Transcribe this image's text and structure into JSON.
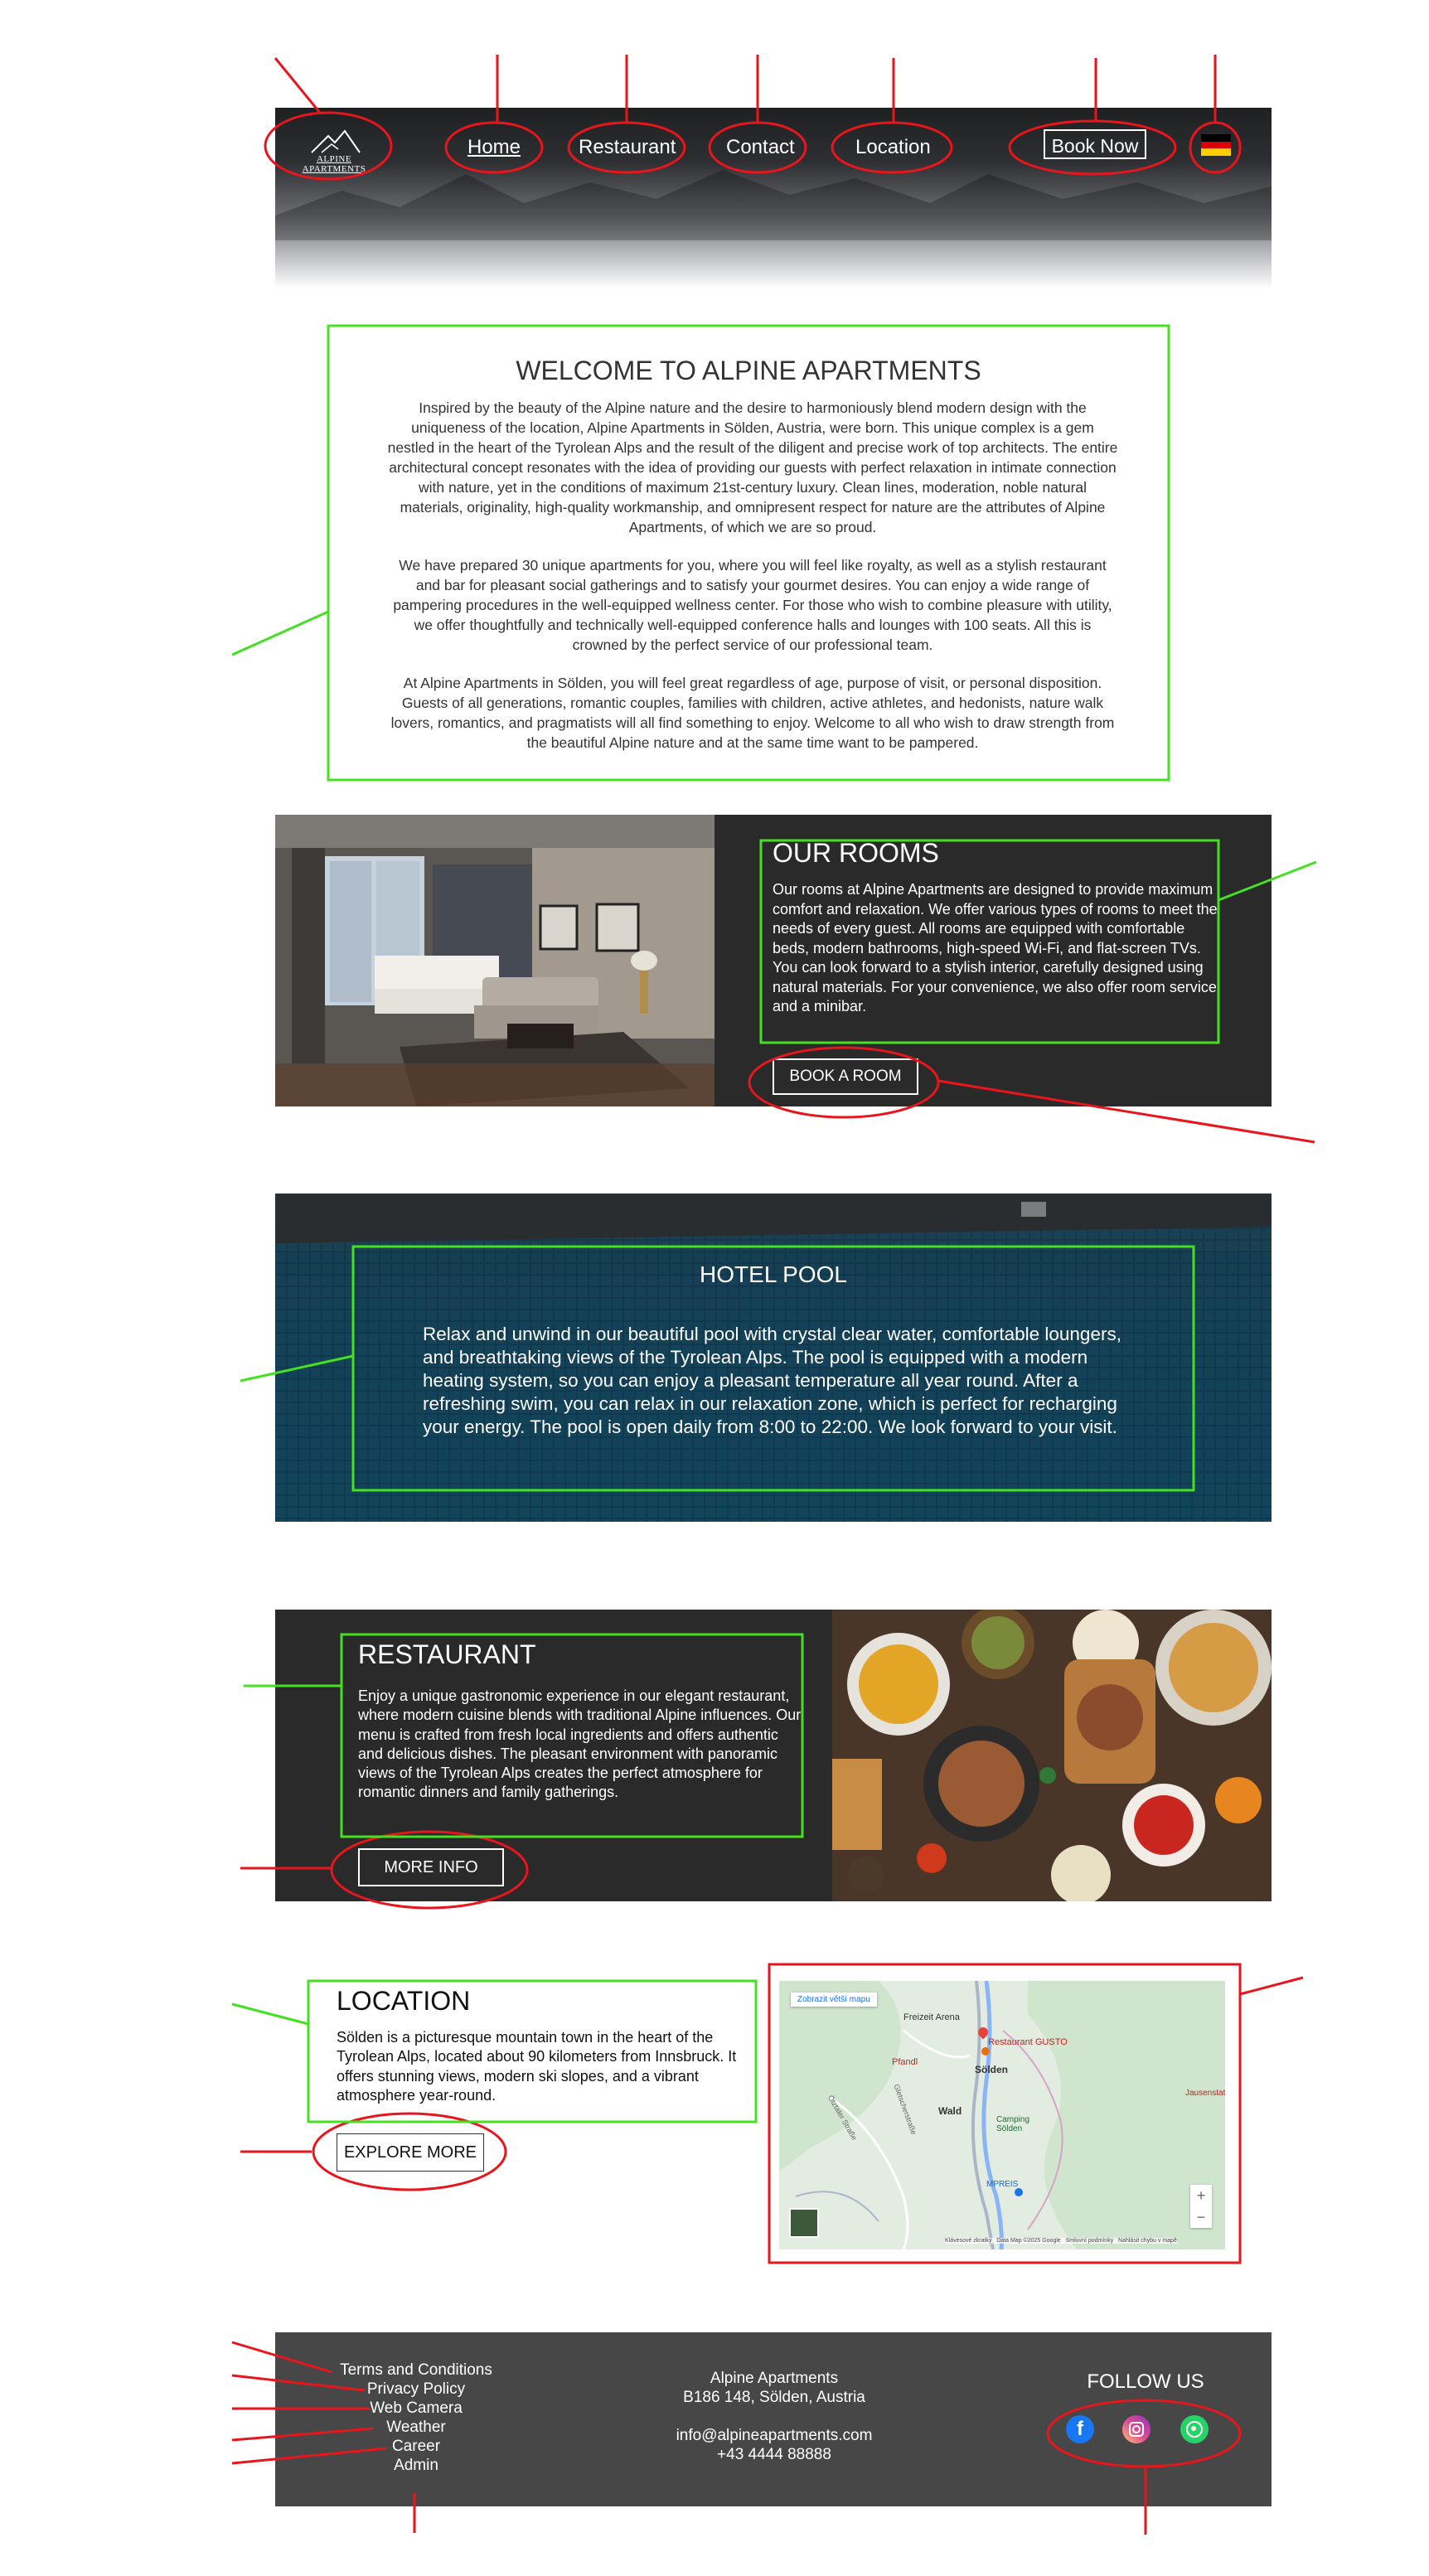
{
  "header": {
    "logo_text": "ALPINE APARTMENTS",
    "nav": [
      "Home",
      "Restaurant",
      "Contact",
      "Location"
    ],
    "book_now": "Book Now",
    "language_flag": "german-flag-icon"
  },
  "welcome": {
    "title": "WELCOME TO ALPINE APARTMENTS",
    "paragraphs": [
      "Inspired by the beauty of the Alpine nature and the desire to harmoniously blend modern design with the uniqueness of the location, Alpine Apartments in Sölden, Austria, were born. This unique complex is a gem nestled in the heart of the Tyrolean Alps and the result of the diligent and precise work of top architects. The entire architectural concept resonates with the idea of providing our guests with perfect relaxation in intimate connection with nature, yet in the conditions of maximum 21st-century luxury. Clean lines, moderation, noble natural materials, originality, high-quality workmanship, and omnipresent respect for nature are the attributes of Alpine Apartments, of which we are so proud.",
      "We have prepared 30 unique apartments for you, where you will feel like royalty, as well as a stylish restaurant and bar for pleasant social gatherings and to satisfy your gourmet desires. You can enjoy a wide range of pampering procedures in the well-equipped wellness center. For those who wish to combine pleasure with utility, we offer thoughtfully and technically well-equipped conference halls and lounges with 100 seats. All this is crowned by the perfect service of our professional team.",
      "At Alpine Apartments in Sölden, you will feel great regardless of age, purpose of visit, or personal disposition. Guests of all generations, romantic couples, families with children, active athletes, and hedonists, nature walk lovers, romantics, and pragmatists will all find something to enjoy. Welcome to all who wish to draw strength from the beautiful Alpine nature and at the same time want to be pampered."
    ]
  },
  "rooms": {
    "title": "OUR ROOMS",
    "text": "Our rooms at Alpine Apartments are designed to provide maximum comfort and relaxation. We offer various types of rooms to meet the needs of every guest. All rooms are equipped with comfortable beds, modern bathrooms, high-speed Wi-Fi, and flat-screen TVs. You can look forward to a stylish interior, carefully designed using natural materials. For your convenience, we also offer room service and a minibar.",
    "button": "BOOK A ROOM"
  },
  "pool": {
    "title": "HOTEL POOL",
    "text": "Relax and unwind in our beautiful pool with crystal clear water, comfortable loungers, and breathtaking views of the Tyrolean Alps. The pool is equipped with a modern heating system, so you can enjoy a pleasant temperature all year round. After a refreshing swim, you can relax in our relaxation zone, which is perfect for recharging your energy. The pool is open daily from 8:00 to 22:00. We look forward to your visit."
  },
  "restaurant": {
    "title": "RESTAURANT",
    "text": "Enjoy a unique gastronomic experience in our elegant restaurant, where modern cuisine blends with traditional Alpine influences. Our menu is crafted from fresh local ingredients and offers authentic and delicious dishes. The pleasant environment with panoramic views of the Tyrolean Alps creates the perfect atmosphere for romantic dinners and family gatherings.",
    "button": "MORE INFO"
  },
  "location": {
    "title": "LOCATION",
    "text": "Sölden is a picturesque mountain town in the heart of the Tyrolean Alps, located about 90 kilometers from Innsbruck. It offers stunning views, modern ski slopes, and a vibrant atmosphere year-round.",
    "button": "EXPLORE MORE",
    "map": {
      "larger_map": "Zobrazit větší mapu",
      "labels": [
        "Freizeit Arena",
        "Restaurant GUSTO",
        "Pfandl",
        "Sölden",
        "Wald",
        "Camping Sölden",
        "MPREIS",
        "Jausenstati",
        "Gletscherstraße",
        "Ötztaler Straße"
      ],
      "zoom_in": "+",
      "zoom_out": "−",
      "attribution": "Klávesové zkratky   Data Map ©2025 Google   Smluvní podmínky   Nahlásit chybu v mapě",
      "pin_color": "#e94235",
      "water_color": "#8ab4f8"
    }
  },
  "footer": {
    "links": [
      "Terms and Conditions",
      "Privacy Policy",
      "Web Camera",
      "Weather",
      "Career",
      "Admin"
    ],
    "address": [
      "Alpine Apartments",
      "B186 148, Sölden, Austria"
    ],
    "contact": [
      "info@alpineapartments.com",
      "+43 4444 88888"
    ],
    "follow": "FOLLOW US",
    "social": [
      {
        "name": "facebook-icon",
        "color": "#1877f2"
      },
      {
        "name": "instagram-icon",
        "color": "#d6249f"
      },
      {
        "name": "whatsapp-icon",
        "color": "#25d366"
      }
    ]
  },
  "colors": {
    "annotation_red": "#e8161c",
    "annotation_green": "#44e021",
    "dark_panel": "#2a2a2a",
    "footer_bg": "#474747"
  }
}
